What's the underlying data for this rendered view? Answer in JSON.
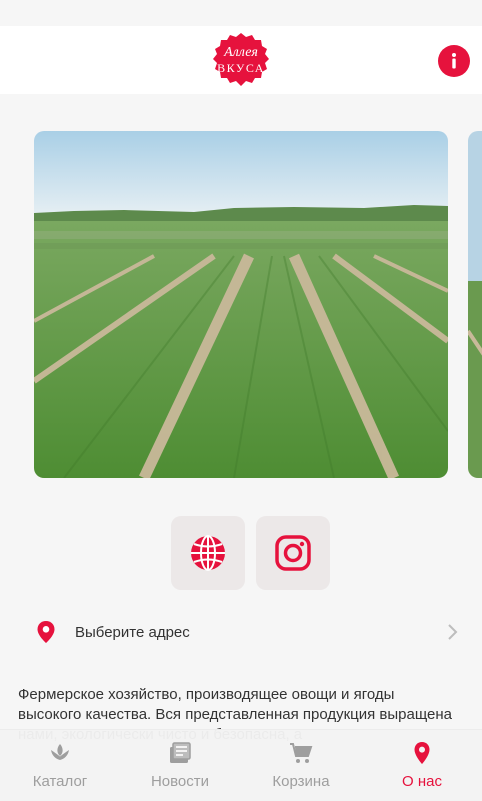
{
  "header": {
    "logo_line1": "Аллея",
    "logo_line2": "вкуса",
    "info_icon": "info-icon"
  },
  "carousel": {
    "slides": [
      "field-photo",
      "field-photo-next"
    ]
  },
  "social": {
    "website_icon": "globe-icon",
    "instagram_icon": "instagram-icon"
  },
  "address": {
    "label": "Выберите адрес",
    "icon": "location-pin-icon"
  },
  "description": "Фермерское хозяйство, производящее овощи и ягоды высокого качества. Вся представленная продукция выращена нами, экологически чисто и безопасна, а",
  "tabs": [
    {
      "label": "Каталог",
      "icon": "leaf-icon",
      "active": false
    },
    {
      "label": "Новости",
      "icon": "news-icon",
      "active": false
    },
    {
      "label": "Корзина",
      "icon": "cart-icon",
      "active": false
    },
    {
      "label": "О нас",
      "icon": "location-pin-icon",
      "active": true
    }
  ],
  "colors": {
    "accent": "#e6123d",
    "inactive": "#9e9e9e",
    "button_bg": "#ece8e8"
  }
}
